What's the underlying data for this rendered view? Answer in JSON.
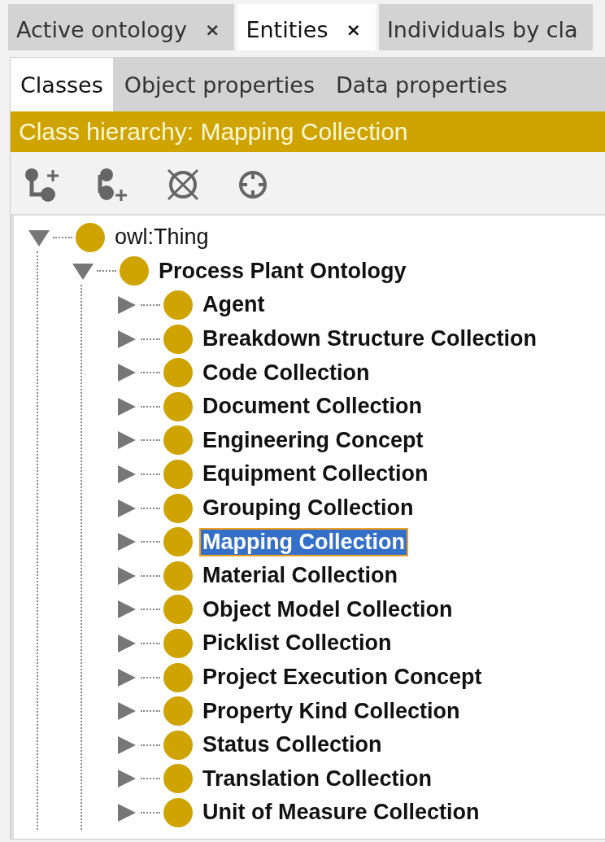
{
  "tabs": [
    {
      "label": "Active ontology",
      "close": "×",
      "selected": false
    },
    {
      "label": "Entities",
      "close": "×",
      "selected": true
    },
    {
      "label": "Individuals by cla",
      "selected": false
    }
  ],
  "subtabs": [
    {
      "label": "Classes",
      "selected": true
    },
    {
      "label": "Object properties",
      "selected": false
    },
    {
      "label": "Data properties",
      "selected": false
    }
  ],
  "view_title": "Class hierarchy: Mapping Collection",
  "toolbar": [
    {
      "kind": "add-subclass"
    },
    {
      "kind": "add-sibling"
    },
    {
      "kind": "delete"
    },
    {
      "kind": "target"
    }
  ],
  "tree": [
    {
      "label": "owl:Thing",
      "bold": false,
      "expanded": true,
      "selected": false,
      "children": [
        {
          "label": "Process Plant Ontology",
          "bold": true,
          "expanded": true,
          "selected": false,
          "children": [
            {
              "label": "Agent",
              "bold": true,
              "expanded": false,
              "selected": false
            },
            {
              "label": "Breakdown Structure Collection",
              "bold": true,
              "expanded": false,
              "selected": false
            },
            {
              "label": "Code Collection",
              "bold": true,
              "expanded": false,
              "selected": false
            },
            {
              "label": "Document Collection",
              "bold": true,
              "expanded": false,
              "selected": false
            },
            {
              "label": "Engineering Concept",
              "bold": true,
              "expanded": false,
              "selected": false
            },
            {
              "label": "Equipment Collection",
              "bold": true,
              "expanded": false,
              "selected": false
            },
            {
              "label": "Grouping Collection",
              "bold": true,
              "expanded": false,
              "selected": false
            },
            {
              "label": "Mapping Collection",
              "bold": true,
              "expanded": false,
              "selected": true
            },
            {
              "label": "Material Collection",
              "bold": true,
              "expanded": false,
              "selected": false
            },
            {
              "label": "Object Model Collection",
              "bold": true,
              "expanded": false,
              "selected": false
            },
            {
              "label": "Picklist Collection",
              "bold": true,
              "expanded": false,
              "selected": false
            },
            {
              "label": "Project Execution Concept",
              "bold": true,
              "expanded": false,
              "selected": false
            },
            {
              "label": "Property Kind Collection",
              "bold": true,
              "expanded": false,
              "selected": false
            },
            {
              "label": "Status Collection",
              "bold": true,
              "expanded": false,
              "selected": false
            },
            {
              "label": "Translation Collection",
              "bold": true,
              "expanded": false,
              "selected": false
            },
            {
              "label": "Unit of Measure Collection",
              "bold": true,
              "expanded": false,
              "selected": false
            }
          ]
        }
      ]
    }
  ]
}
